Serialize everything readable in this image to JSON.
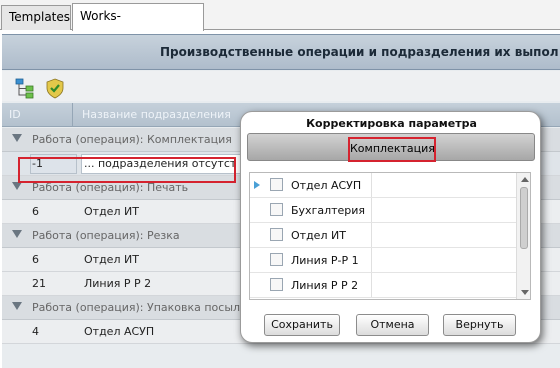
{
  "tabs": [
    {
      "label": "Templates"
    },
    {
      "label": "Works-Departments"
    }
  ],
  "panel": {
    "title": "Производственные операции и подразделения их выпол"
  },
  "grid": {
    "columns": {
      "id": "ID",
      "name": "Название подразделения"
    },
    "rows": [
      {
        "kind": "group",
        "text": "Работа (операция): Комплектация"
      },
      {
        "kind": "data",
        "id": "-1",
        "name": "... подразделения отсутст",
        "selected": true
      },
      {
        "kind": "group",
        "text": "Работа (операция): Печать"
      },
      {
        "kind": "data",
        "id": "6",
        "name": "Отдел ИТ"
      },
      {
        "kind": "group",
        "text": "Работа (операция): Резка"
      },
      {
        "kind": "data",
        "id": "6",
        "name": "Отдел ИТ"
      },
      {
        "kind": "data",
        "id": "21",
        "name": "Линия Р Р 2"
      },
      {
        "kind": "group",
        "text": "Работа (операция): Упаковка посыл"
      },
      {
        "kind": "data",
        "id": "4",
        "name": "Отдел АСУП"
      }
    ]
  },
  "dialog": {
    "title": "Корректировка параметра",
    "parameter": "Комплектация",
    "items": [
      {
        "label": "Отдел АСУП",
        "checked": false,
        "current": true
      },
      {
        "label": "Бухгалтерия",
        "checked": false
      },
      {
        "label": "Отдел ИТ",
        "checked": false
      },
      {
        "label": "Линия Р-Р 1",
        "checked": false
      },
      {
        "label": "Линия Р Р 2",
        "checked": false
      }
    ],
    "buttons": {
      "save": "Сохранить",
      "cancel": "Отмена",
      "return": "Вернуть"
    }
  },
  "colors": {
    "highlight": "#d5232f",
    "header": "#b3c1ce",
    "group_row": "#d9dde1"
  }
}
